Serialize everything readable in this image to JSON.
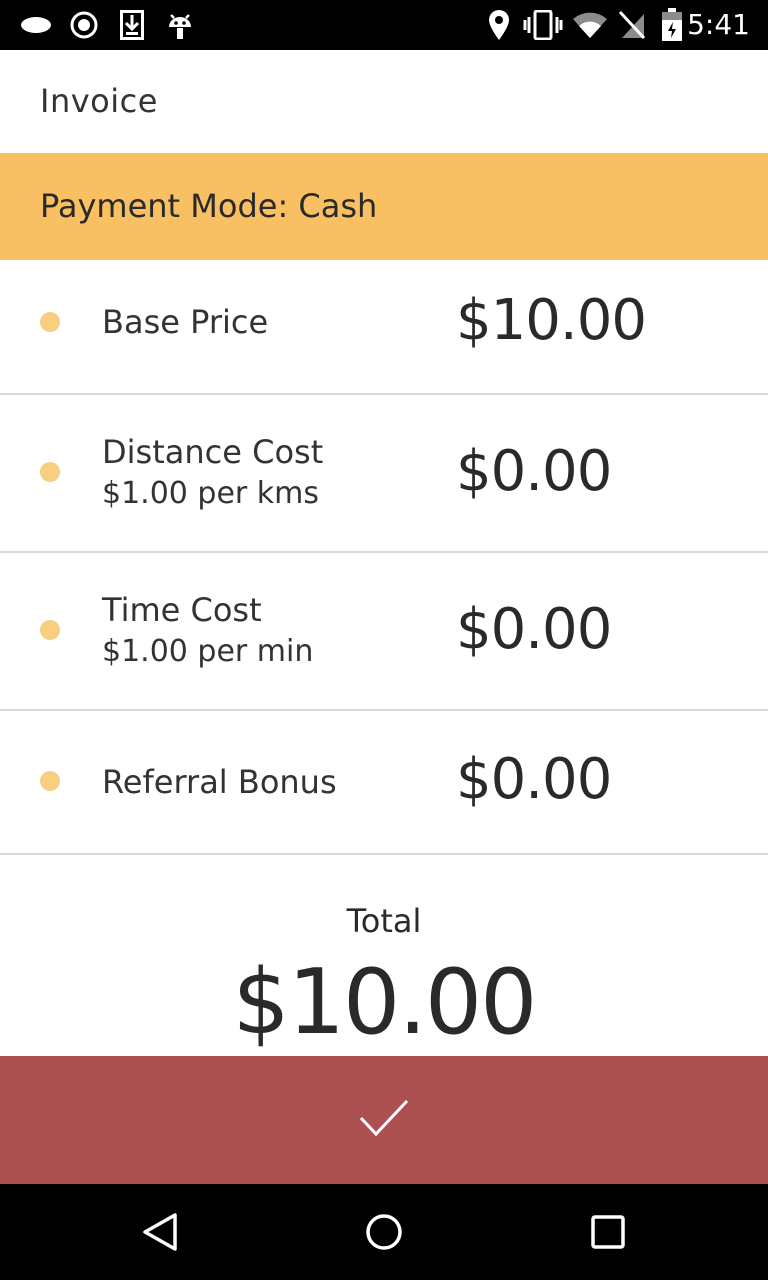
{
  "status_bar": {
    "time": "5:41",
    "icons": [
      "notification-oval-icon",
      "record-icon",
      "download-icon",
      "android-icon",
      "location-icon",
      "vibrate-icon",
      "wifi-icon",
      "no-sim-icon",
      "battery-icon"
    ]
  },
  "header": {
    "title": "Invoice"
  },
  "payment": {
    "mode_label": "Payment Mode: Cash"
  },
  "items": [
    {
      "name": "Base Price",
      "sub": "",
      "amount": "$10.00"
    },
    {
      "name": "Distance Cost",
      "sub": "$1.00 per kms",
      "amount": "$0.00"
    },
    {
      "name": "Time Cost",
      "sub": "$1.00 per min",
      "amount": "$0.00"
    },
    {
      "name": "Referral Bonus",
      "sub": "",
      "amount": "$0.00"
    }
  ],
  "total": {
    "label": "Total",
    "value": "$10.00"
  },
  "confirm": {
    "icon": "checkmark-icon"
  },
  "navbar": {
    "icons": [
      "back-icon",
      "home-icon",
      "recents-icon"
    ]
  },
  "colors": {
    "accent": "#f8c062",
    "dot": "#f8cf80",
    "confirm_bg": "#ad5051"
  }
}
